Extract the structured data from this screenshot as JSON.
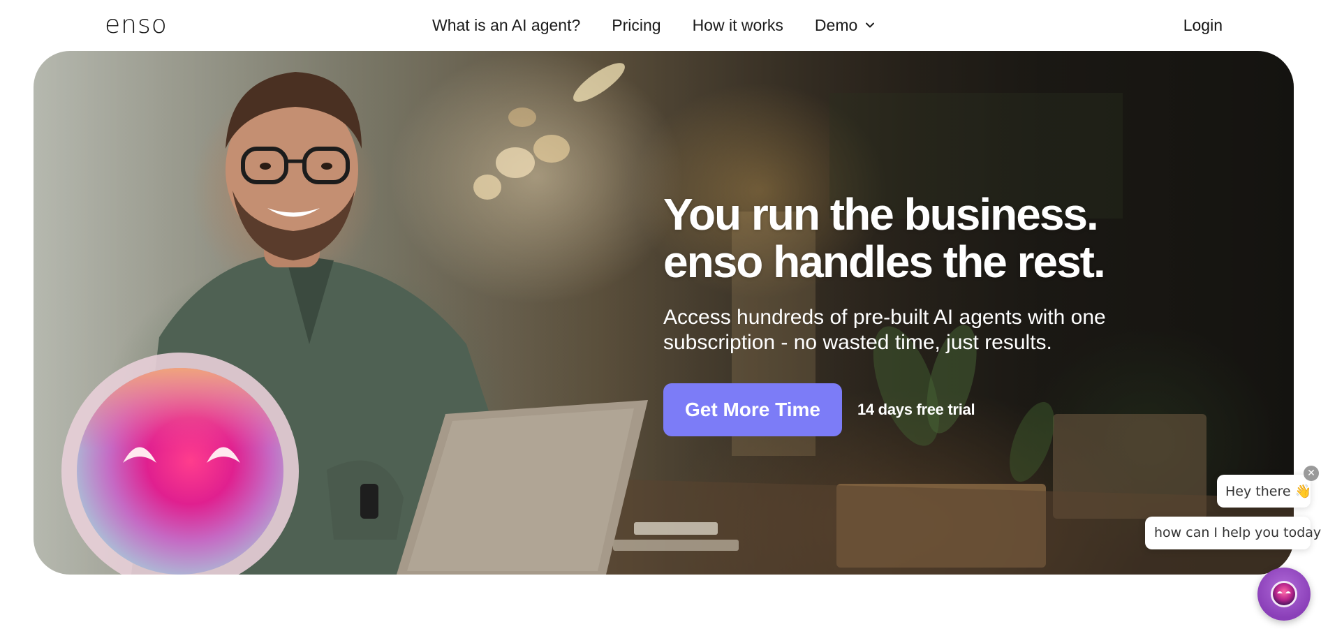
{
  "nav": {
    "logo": "enso",
    "links": [
      "What is an AI agent?",
      "Pricing",
      "How it works",
      "Demo"
    ],
    "login": "Login"
  },
  "hero": {
    "headline": "You run the business. enso handles the rest.",
    "subheadline": "Access hundreds of pre-built AI agents with one subscription - no wasted time, just results.",
    "cta_label": "Get More Time",
    "trial_text": "14 days free trial",
    "cta_color": "#7c7cf7"
  },
  "chat": {
    "greeting": "Hey there 👋",
    "prompt": "how can I help you today?",
    "close_icon": "close-icon",
    "launcher_icon": "chat-avatar-icon",
    "launcher_color": "#9b4fc9"
  }
}
